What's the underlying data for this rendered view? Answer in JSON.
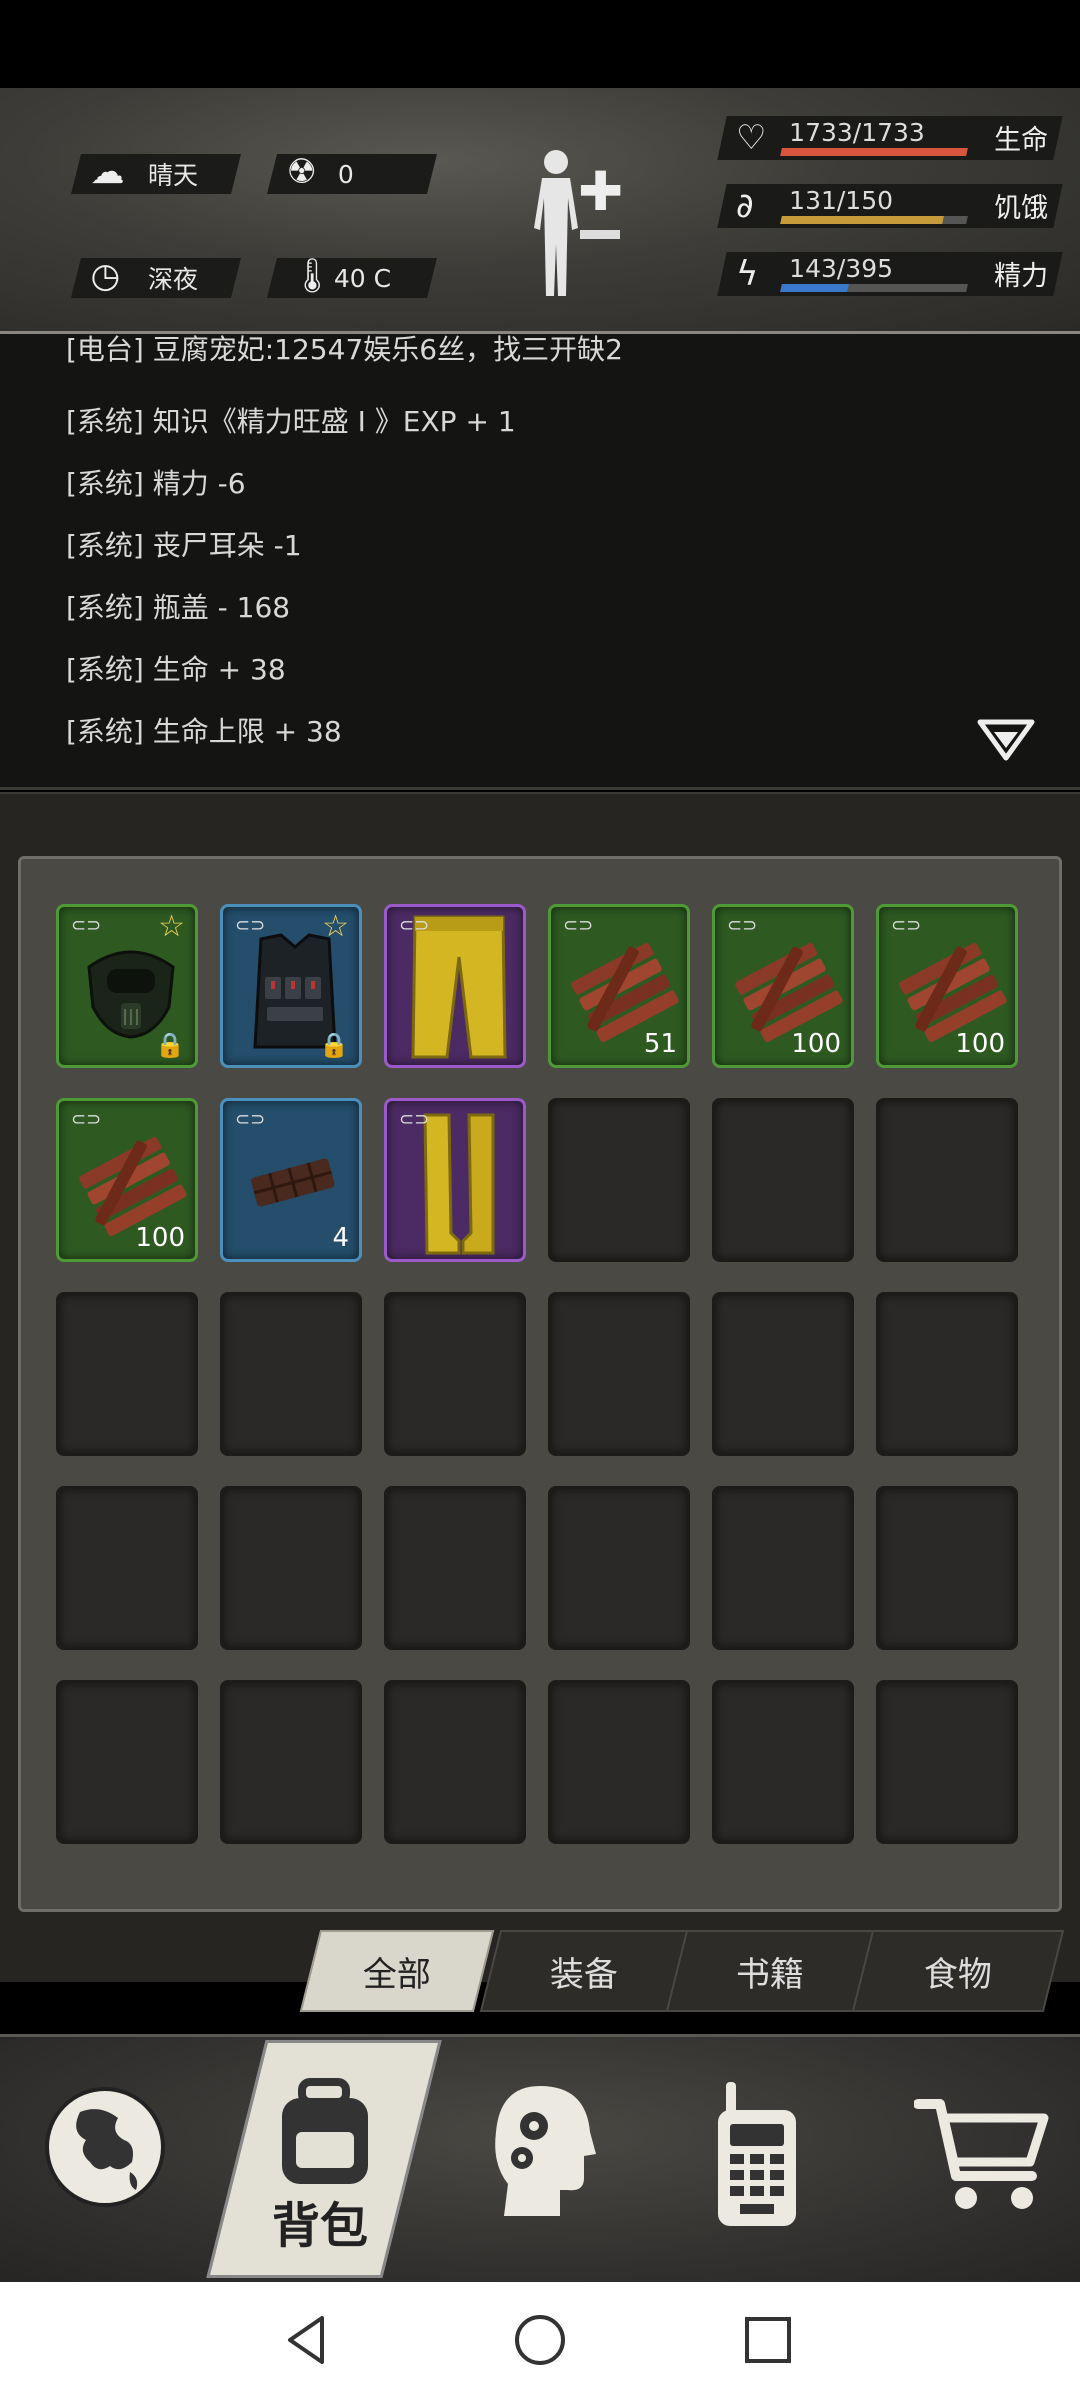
{
  "header": {
    "weather": {
      "icon": "cloud-sun-icon",
      "label": "晴天"
    },
    "radiation": {
      "icon": "radiation-icon",
      "value": "0"
    },
    "time_of_day": {
      "icon": "clock-icon",
      "label": "深夜"
    },
    "temperature": {
      "icon": "thermometer-icon",
      "value": "40 C"
    },
    "stats": [
      {
        "icon": "heart-icon",
        "value": "1733/1733",
        "label": "生命",
        "fraction": 1.0,
        "color": "#d9553d"
      },
      {
        "icon": "stomach-icon",
        "value": "131/150",
        "label": "饥饿",
        "fraction": 0.873,
        "color": "#c79a3a"
      },
      {
        "icon": "energy-icon",
        "value": "143/395",
        "label": "精力",
        "fraction": 0.362,
        "color": "#3a78c9"
      }
    ]
  },
  "log": {
    "lines": [
      "[电台] 豆腐宠妃:12547娱乐6丝，找三开缺2",
      "[系统] 知识《精力旺盛 I 》EXP + 1",
      "[系统] 精力 -6",
      "[系统] 丧尸耳朵 -1",
      "[系统] 瓶盖 - 168",
      "[系统] 生命 + 38",
      "[系统] 生命上限 + 38"
    ]
  },
  "inventory": {
    "items": [
      {
        "name": "gas-mask",
        "rarity": "green",
        "star": true,
        "locked": true,
        "qty": ""
      },
      {
        "name": "tactical-vest",
        "rarity": "blue",
        "star": true,
        "locked": true,
        "qty": ""
      },
      {
        "name": "yellow-pants",
        "rarity": "purple",
        "star": false,
        "locked": false,
        "qty": ""
      },
      {
        "name": "wood-planks",
        "rarity": "green",
        "star": false,
        "locked": false,
        "qty": "51"
      },
      {
        "name": "wood-planks",
        "rarity": "green",
        "star": false,
        "locked": false,
        "qty": "100"
      },
      {
        "name": "wood-planks",
        "rarity": "green",
        "star": false,
        "locked": false,
        "qty": "100"
      },
      {
        "name": "wood-planks",
        "rarity": "green",
        "star": false,
        "locked": false,
        "qty": "100"
      },
      {
        "name": "chocolate",
        "rarity": "blue",
        "star": false,
        "locked": false,
        "qty": "4"
      },
      {
        "name": "yellow-boots",
        "rarity": "purple",
        "star": false,
        "locked": false,
        "qty": ""
      }
    ],
    "total_slots": 30
  },
  "tabs": [
    {
      "label": "全部",
      "active": true
    },
    {
      "label": "装备",
      "active": false
    },
    {
      "label": "书籍",
      "active": false
    },
    {
      "label": "食物",
      "active": false
    }
  ],
  "nav": {
    "items": [
      {
        "name": "world-map",
        "icon": "globe-icon"
      },
      {
        "name": "backpack",
        "icon": "backpack-icon",
        "label": "背包",
        "active": true
      },
      {
        "name": "skills",
        "icon": "head-gears-icon"
      },
      {
        "name": "radio",
        "icon": "walkie-talkie-icon"
      },
      {
        "name": "shop",
        "icon": "cart-icon"
      }
    ]
  },
  "system_nav": [
    "back-icon",
    "home-icon",
    "recents-icon"
  ]
}
